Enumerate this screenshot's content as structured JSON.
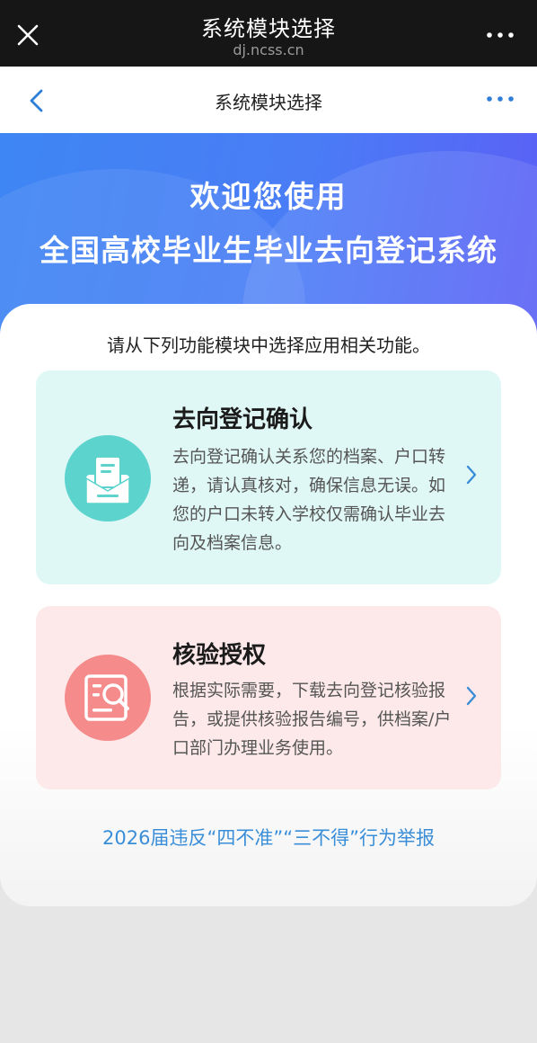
{
  "webview": {
    "title": "系统模块选择",
    "url": "dj.ncss.cn",
    "close_icon": "close-icon",
    "more_icon": "more-icon"
  },
  "navbar": {
    "title": "系统模块选择",
    "back_icon": "chevron-left-icon",
    "more_icon": "more-icon"
  },
  "hero": {
    "welcome": "欢迎您使用",
    "system_name": "全国高校毕业生毕业去向登记系统"
  },
  "main": {
    "intro": "请从下列功能模块中选择应用相关功能。",
    "modules": [
      {
        "title": "去向登记确认",
        "description": "去向登记确认关系您的档案、户口转递，请认真核对，确保信息无误。如您的户口未转入学校仅需确认毕业去向及档案信息。",
        "icon": "envelope-document-icon",
        "color": "#5cd3cc"
      },
      {
        "title": "核验授权",
        "description": "根据实际需要，下载去向登记核验报告，或提供核验报告编号，供档案/户口部门办理业务使用。",
        "icon": "document-search-icon",
        "color": "#f58b8b"
      }
    ],
    "report_link": "2026届违反“四不准”“三不得”行为举报"
  },
  "colors": {
    "accent": "#3a8ed8",
    "hero_start": "#3e86f3",
    "hero_end": "#5b5ff5"
  }
}
